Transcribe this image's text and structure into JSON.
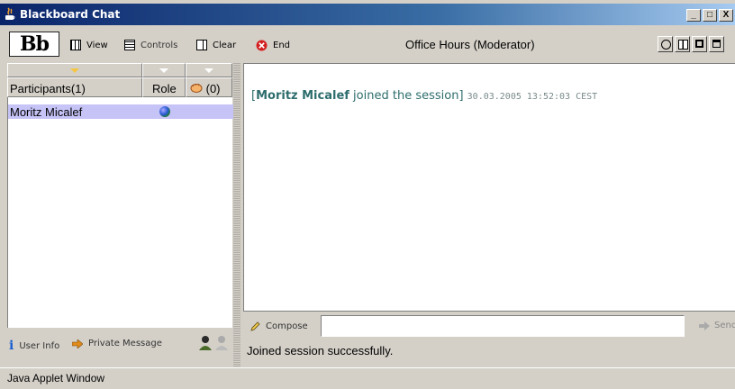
{
  "window": {
    "title": "Blackboard Chat",
    "controls": {
      "minimize": "_",
      "maximize": "□",
      "close": "X"
    }
  },
  "toolbar": {
    "logo": "Bb",
    "view_label": "View",
    "controls_label": "Controls",
    "clear_label": "Clear",
    "end_label": "End",
    "session_title": "Office Hours (Moderator)"
  },
  "participants": {
    "col_participants": "Participants(1)",
    "col_role": "Role",
    "col_hand": "(0)",
    "rows": [
      {
        "name": "Moritz Micalef",
        "role_icon": "globe-icon"
      }
    ],
    "footer": {
      "user_info": "User Info",
      "private_message": "Private Message"
    }
  },
  "chat": {
    "message": {
      "prefix": "[",
      "user": "Moritz Micalef",
      "text": " joined the session]",
      "timestamp": "30.03.2005 13:52:03 CEST"
    },
    "compose_label": "Compose",
    "compose_value": "",
    "send_label": "Send",
    "status": "Joined session successfully."
  },
  "applet_label": "Java Applet Window",
  "colors": {
    "titlebar_start": "#0a246a",
    "titlebar_end": "#a6caf0",
    "selection": "#c6c3f7",
    "chat_text": "#2e6d6d",
    "end_icon": "#d32020"
  }
}
